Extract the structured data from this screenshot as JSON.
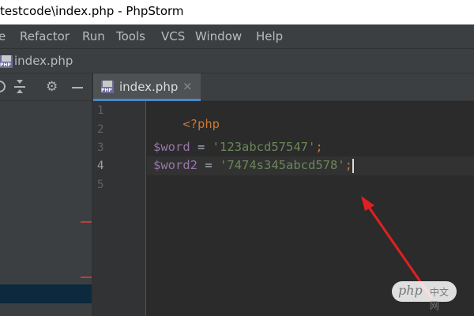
{
  "window": {
    "title": "testcode\\index.php - PhpStorm"
  },
  "menu": [
    "e",
    "Refactor",
    "Run",
    "Tools",
    "VCS",
    "Window",
    "Help"
  ],
  "navigation": {
    "file": "index.php"
  },
  "editor": {
    "tab_label": "index.php",
    "tab_close": "×",
    "line_numbers": [
      "1",
      "2",
      "3",
      "4",
      "5"
    ],
    "current_line": 4,
    "code": {
      "line1": "<?php",
      "line3": {
        "var": "$word",
        "eq": " = ",
        "str": "'123abcd57547'",
        "semi": ";"
      },
      "line4": {
        "var": "$word2",
        "eq": " = ",
        "str": "'7474s345abcd578'",
        "semi": ";"
      }
    }
  },
  "watermark": {
    "text": "php",
    "cn": "中文网"
  },
  "colors": {
    "keyword": "#cc7832",
    "variable": "#9876aa",
    "string": "#6a8759",
    "annotation_arrow": "#e02020",
    "tab_underline": "#4a88c7"
  }
}
